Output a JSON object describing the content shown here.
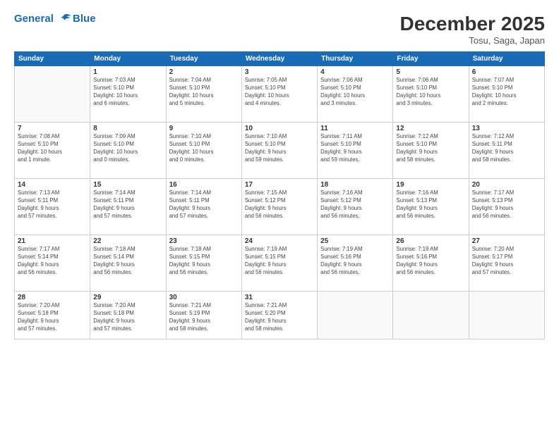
{
  "logo": {
    "line1": "General",
    "line2": "Blue"
  },
  "title": "December 2025",
  "location": "Tosu, Saga, Japan",
  "headers": [
    "Sunday",
    "Monday",
    "Tuesday",
    "Wednesday",
    "Thursday",
    "Friday",
    "Saturday"
  ],
  "weeks": [
    [
      {
        "day": "",
        "info": ""
      },
      {
        "day": "1",
        "info": "Sunrise: 7:03 AM\nSunset: 5:10 PM\nDaylight: 10 hours\nand 6 minutes."
      },
      {
        "day": "2",
        "info": "Sunrise: 7:04 AM\nSunset: 5:10 PM\nDaylight: 10 hours\nand 5 minutes."
      },
      {
        "day": "3",
        "info": "Sunrise: 7:05 AM\nSunset: 5:10 PM\nDaylight: 10 hours\nand 4 minutes."
      },
      {
        "day": "4",
        "info": "Sunrise: 7:06 AM\nSunset: 5:10 PM\nDaylight: 10 hours\nand 3 minutes."
      },
      {
        "day": "5",
        "info": "Sunrise: 7:06 AM\nSunset: 5:10 PM\nDaylight: 10 hours\nand 3 minutes."
      },
      {
        "day": "6",
        "info": "Sunrise: 7:07 AM\nSunset: 5:10 PM\nDaylight: 10 hours\nand 2 minutes."
      }
    ],
    [
      {
        "day": "7",
        "info": "Sunrise: 7:08 AM\nSunset: 5:10 PM\nDaylight: 10 hours\nand 1 minute."
      },
      {
        "day": "8",
        "info": "Sunrise: 7:09 AM\nSunset: 5:10 PM\nDaylight: 10 hours\nand 0 minutes."
      },
      {
        "day": "9",
        "info": "Sunrise: 7:10 AM\nSunset: 5:10 PM\nDaylight: 10 hours\nand 0 minutes."
      },
      {
        "day": "10",
        "info": "Sunrise: 7:10 AM\nSunset: 5:10 PM\nDaylight: 9 hours\nand 59 minutes."
      },
      {
        "day": "11",
        "info": "Sunrise: 7:11 AM\nSunset: 5:10 PM\nDaylight: 9 hours\nand 59 minutes."
      },
      {
        "day": "12",
        "info": "Sunrise: 7:12 AM\nSunset: 5:10 PM\nDaylight: 9 hours\nand 58 minutes."
      },
      {
        "day": "13",
        "info": "Sunrise: 7:12 AM\nSunset: 5:11 PM\nDaylight: 9 hours\nand 58 minutes."
      }
    ],
    [
      {
        "day": "14",
        "info": "Sunrise: 7:13 AM\nSunset: 5:11 PM\nDaylight: 9 hours\nand 57 minutes."
      },
      {
        "day": "15",
        "info": "Sunrise: 7:14 AM\nSunset: 5:11 PM\nDaylight: 9 hours\nand 57 minutes."
      },
      {
        "day": "16",
        "info": "Sunrise: 7:14 AM\nSunset: 5:11 PM\nDaylight: 9 hours\nand 57 minutes."
      },
      {
        "day": "17",
        "info": "Sunrise: 7:15 AM\nSunset: 5:12 PM\nDaylight: 9 hours\nand 56 minutes."
      },
      {
        "day": "18",
        "info": "Sunrise: 7:16 AM\nSunset: 5:12 PM\nDaylight: 9 hours\nand 56 minutes."
      },
      {
        "day": "19",
        "info": "Sunrise: 7:16 AM\nSunset: 5:13 PM\nDaylight: 9 hours\nand 56 minutes."
      },
      {
        "day": "20",
        "info": "Sunrise: 7:17 AM\nSunset: 5:13 PM\nDaylight: 9 hours\nand 56 minutes."
      }
    ],
    [
      {
        "day": "21",
        "info": "Sunrise: 7:17 AM\nSunset: 5:14 PM\nDaylight: 9 hours\nand 56 minutes."
      },
      {
        "day": "22",
        "info": "Sunrise: 7:18 AM\nSunset: 5:14 PM\nDaylight: 9 hours\nand 56 minutes."
      },
      {
        "day": "23",
        "info": "Sunrise: 7:18 AM\nSunset: 5:15 PM\nDaylight: 9 hours\nand 56 minutes."
      },
      {
        "day": "24",
        "info": "Sunrise: 7:19 AM\nSunset: 5:15 PM\nDaylight: 9 hours\nand 56 minutes."
      },
      {
        "day": "25",
        "info": "Sunrise: 7:19 AM\nSunset: 5:16 PM\nDaylight: 9 hours\nand 56 minutes."
      },
      {
        "day": "26",
        "info": "Sunrise: 7:19 AM\nSunset: 5:16 PM\nDaylight: 9 hours\nand 56 minutes."
      },
      {
        "day": "27",
        "info": "Sunrise: 7:20 AM\nSunset: 5:17 PM\nDaylight: 9 hours\nand 57 minutes."
      }
    ],
    [
      {
        "day": "28",
        "info": "Sunrise: 7:20 AM\nSunset: 5:18 PM\nDaylight: 9 hours\nand 57 minutes."
      },
      {
        "day": "29",
        "info": "Sunrise: 7:20 AM\nSunset: 5:18 PM\nDaylight: 9 hours\nand 57 minutes."
      },
      {
        "day": "30",
        "info": "Sunrise: 7:21 AM\nSunset: 5:19 PM\nDaylight: 9 hours\nand 58 minutes."
      },
      {
        "day": "31",
        "info": "Sunrise: 7:21 AM\nSunset: 5:20 PM\nDaylight: 9 hours\nand 58 minutes."
      },
      {
        "day": "",
        "info": ""
      },
      {
        "day": "",
        "info": ""
      },
      {
        "day": "",
        "info": ""
      }
    ]
  ]
}
